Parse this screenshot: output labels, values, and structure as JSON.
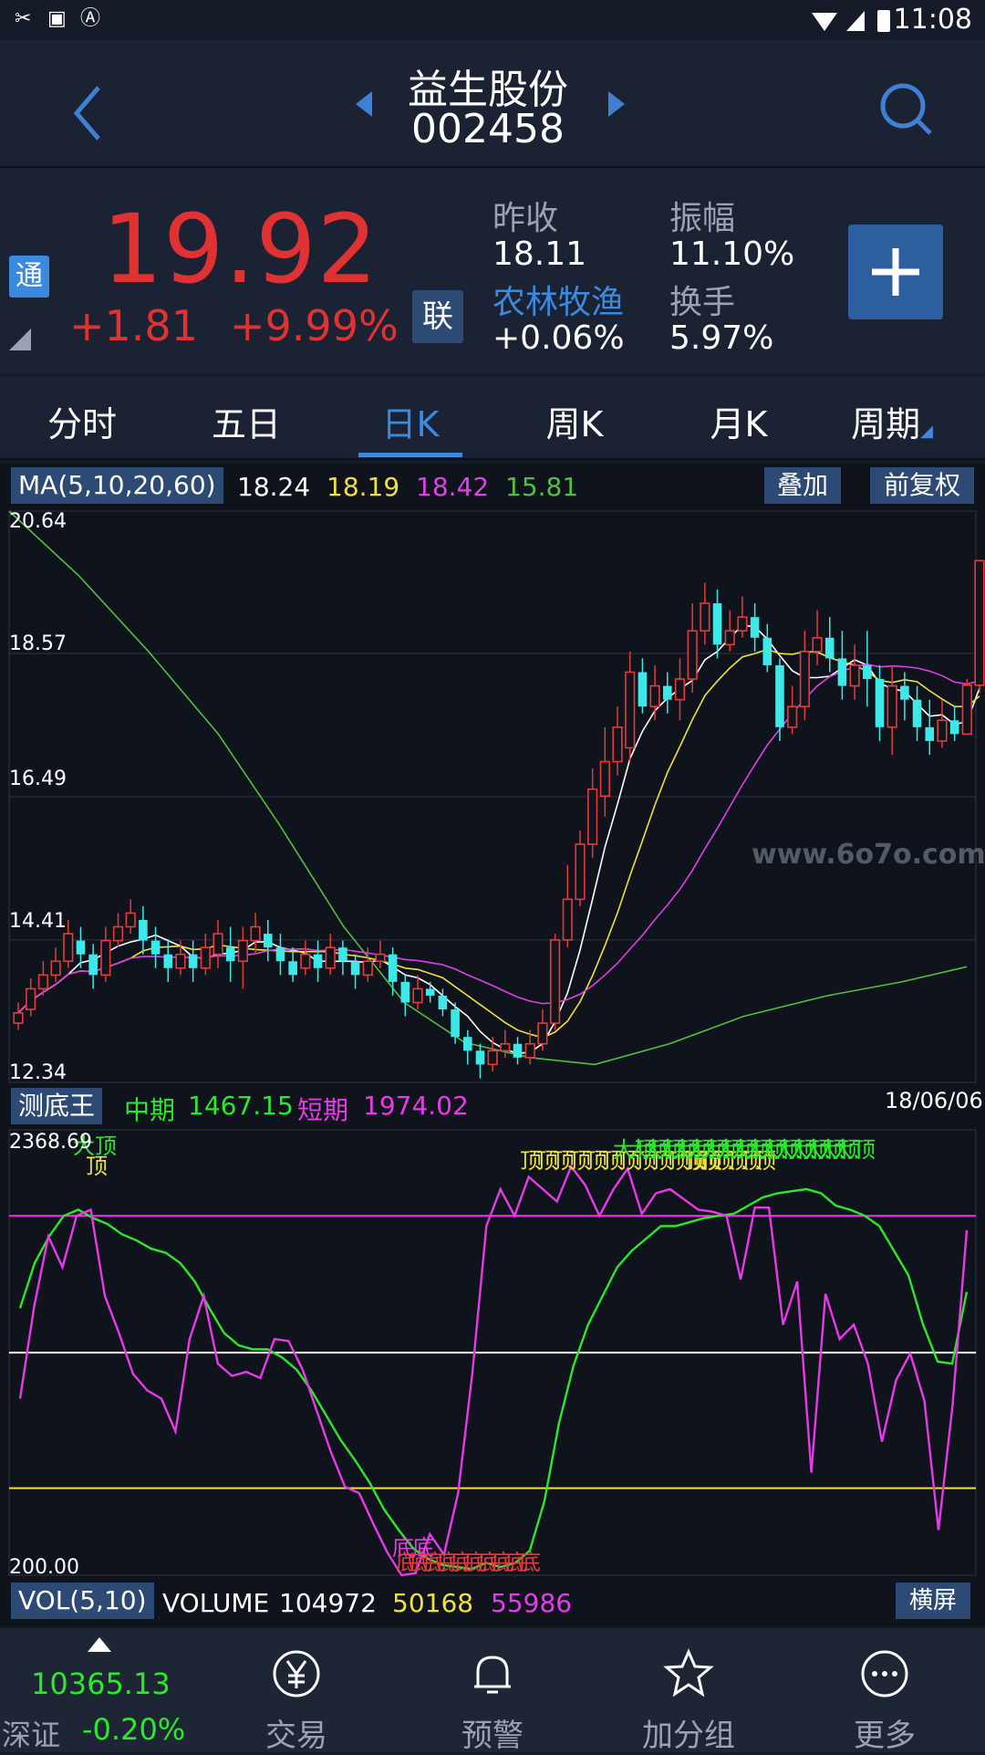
{
  "status_bar": {
    "time": "11:08"
  },
  "header": {
    "stock_name": "益生股份",
    "stock_code": "002458"
  },
  "quote": {
    "tong": "通",
    "price": "19.92",
    "change": "+1.81",
    "change_pct": "+9.99%",
    "lian": "联",
    "prev_close_label": "昨收",
    "prev_close": "18.11",
    "amplitude_label": "振幅",
    "amplitude": "11.10%",
    "sector": "农林牧渔",
    "sector_change": "+0.06%",
    "turnover_label": "换手",
    "turnover": "5.97%"
  },
  "tabs": [
    {
      "label": "分时"
    },
    {
      "label": "五日"
    },
    {
      "label": "日K"
    },
    {
      "label": "周K"
    },
    {
      "label": "月K"
    },
    {
      "label": "周期"
    }
  ],
  "ma_bar": {
    "label": "MA(5,10,20,60)",
    "values": [
      "18.24",
      "18.19",
      "18.42",
      "15.81"
    ],
    "colors": [
      "#ffffff",
      "#f0e040",
      "#e040e8",
      "#50c040"
    ],
    "overlay_label": "叠加",
    "fq_label": "前复权"
  },
  "chart_data": [
    {
      "type": "candlestick",
      "y_ticks": [
        "20.64",
        "18.57",
        "16.49",
        "14.41",
        "12.34"
      ],
      "ylim": [
        12.34,
        20.64
      ],
      "date_label": "18/06/06",
      "watermark": "www.6o7o.com",
      "candles": [
        [
          13.2,
          13.35,
          13.1,
          13.5
        ],
        [
          13.4,
          13.7,
          13.3,
          13.85
        ],
        [
          13.7,
          13.9,
          13.6,
          14.1
        ],
        [
          13.9,
          14.1,
          13.8,
          14.3
        ],
        [
          14.1,
          14.5,
          14.0,
          14.7
        ],
        [
          14.4,
          14.2,
          14.0,
          14.6
        ],
        [
          14.2,
          13.9,
          13.7,
          14.35
        ],
        [
          13.9,
          14.4,
          13.8,
          14.6
        ],
        [
          14.4,
          14.6,
          14.3,
          14.8
        ],
        [
          14.6,
          14.8,
          14.5,
          15.0
        ],
        [
          14.7,
          14.4,
          14.2,
          14.9
        ],
        [
          14.4,
          14.2,
          14.0,
          14.6
        ],
        [
          14.2,
          14.0,
          13.8,
          14.4
        ],
        [
          14.0,
          14.2,
          13.9,
          14.4
        ],
        [
          14.2,
          14.0,
          13.8,
          14.4
        ],
        [
          14.0,
          14.3,
          13.9,
          14.5
        ],
        [
          14.2,
          14.5,
          14.0,
          14.7
        ],
        [
          14.3,
          14.1,
          13.8,
          14.6
        ],
        [
          14.1,
          14.4,
          13.7,
          14.6
        ],
        [
          14.4,
          14.6,
          14.2,
          14.8
        ],
        [
          14.5,
          14.3,
          14.1,
          14.7
        ],
        [
          14.3,
          14.1,
          13.9,
          14.5
        ],
        [
          14.1,
          13.9,
          13.8,
          14.3
        ],
        [
          14.0,
          14.2,
          13.9,
          14.4
        ],
        [
          14.2,
          14.0,
          13.8,
          14.4
        ],
        [
          14.0,
          14.3,
          13.9,
          14.5
        ],
        [
          14.3,
          14.1,
          13.9,
          14.4
        ],
        [
          14.1,
          13.9,
          13.7,
          14.2
        ],
        [
          13.9,
          14.1,
          13.8,
          14.3
        ],
        [
          14.1,
          14.2,
          14.0,
          14.4
        ],
        [
          14.2,
          13.8,
          13.6,
          14.3
        ],
        [
          13.8,
          13.5,
          13.3,
          13.9
        ],
        [
          13.5,
          13.7,
          13.4,
          13.9
        ],
        [
          13.7,
          13.6,
          13.5,
          13.8
        ],
        [
          13.6,
          13.4,
          13.3,
          13.7
        ],
        [
          13.4,
          13.0,
          12.9,
          13.5
        ],
        [
          13.0,
          12.8,
          12.6,
          13.1
        ],
        [
          12.8,
          12.6,
          12.4,
          12.9
        ],
        [
          12.6,
          12.8,
          12.5,
          13.0
        ],
        [
          12.8,
          12.9,
          12.7,
          13.1
        ],
        [
          12.9,
          12.7,
          12.6,
          13.0
        ],
        [
          12.7,
          12.9,
          12.6,
          13.1
        ],
        [
          12.9,
          13.2,
          12.8,
          13.4
        ],
        [
          13.2,
          14.41,
          13.1,
          14.5
        ],
        [
          14.41,
          15.0,
          14.3,
          15.5
        ],
        [
          15.0,
          15.8,
          14.9,
          16.0
        ],
        [
          15.8,
          16.6,
          15.6,
          16.9
        ],
        [
          16.5,
          17.0,
          16.2,
          17.5
        ],
        [
          17.0,
          17.5,
          16.8,
          17.8
        ],
        [
          17.2,
          18.3,
          17.0,
          18.6
        ],
        [
          18.3,
          17.8,
          17.7,
          18.5
        ],
        [
          17.8,
          18.1,
          17.6,
          18.4
        ],
        [
          18.1,
          17.9,
          17.7,
          18.3
        ],
        [
          17.9,
          18.2,
          17.6,
          18.5
        ],
        [
          18.2,
          18.9,
          18.0,
          19.3
        ],
        [
          18.9,
          19.3,
          18.7,
          19.6
        ],
        [
          19.3,
          18.7,
          18.5,
          19.5
        ],
        [
          18.7,
          18.9,
          18.6,
          19.2
        ],
        [
          18.9,
          19.1,
          18.8,
          19.4
        ],
        [
          19.1,
          18.8,
          18.6,
          19.3
        ],
        [
          18.8,
          18.4,
          18.3,
          19.0
        ],
        [
          18.4,
          17.5,
          17.3,
          18.5
        ],
        [
          17.5,
          17.8,
          17.4,
          18.1
        ],
        [
          17.8,
          18.6,
          17.6,
          18.9
        ],
        [
          18.6,
          18.8,
          18.4,
          19.2
        ],
        [
          18.8,
          18.5,
          18.3,
          19.1
        ],
        [
          18.5,
          18.1,
          17.9,
          18.9
        ],
        [
          18.1,
          18.4,
          17.9,
          18.7
        ],
        [
          18.4,
          18.2,
          17.8,
          18.9
        ],
        [
          18.2,
          17.5,
          17.3,
          18.4
        ],
        [
          17.5,
          18.1,
          17.1,
          18.4
        ],
        [
          18.1,
          17.9,
          17.6,
          18.3
        ],
        [
          17.9,
          17.5,
          17.3,
          18.1
        ],
        [
          17.5,
          17.3,
          17.1,
          17.9
        ],
        [
          17.3,
          17.6,
          17.2,
          17.9
        ],
        [
          17.6,
          17.4,
          17.3,
          17.8
        ],
        [
          17.4,
          18.11,
          17.4,
          18.2
        ],
        [
          18.11,
          19.92,
          18.0,
          19.92
        ]
      ],
      "ma60_points": [
        [
          0,
          20.64
        ],
        [
          15,
          19.7
        ],
        [
          30,
          18.6
        ],
        [
          45,
          17.4
        ],
        [
          58,
          16.1
        ],
        [
          72,
          14.6
        ],
        [
          85,
          13.5
        ],
        [
          98,
          12.92
        ],
        [
          112,
          12.7
        ],
        [
          126,
          12.6
        ],
        [
          142,
          12.9
        ],
        [
          158,
          13.3
        ],
        [
          176,
          13.6
        ],
        [
          192,
          13.8
        ],
        [
          206,
          14.02
        ]
      ]
    },
    {
      "type": "line",
      "title": "测底王",
      "series_labels": [
        {
          "name": "中期",
          "value": "1467.15",
          "color": "#2be82b"
        },
        {
          "name": "短期",
          "value": "1974.02",
          "color": "#e83ae8"
        }
      ],
      "y_ticks": [
        "2368.69",
        "200.00"
      ],
      "ylim": [
        200.0,
        2368.69
      ],
      "levels": [
        1950,
        1284,
        624
      ],
      "top_marks": [
        "大顶",
        "顶"
      ],
      "bottom_marks": [
        "底",
        "底"
      ],
      "mid_series": [
        1500,
        1720,
        1850,
        1950,
        1980,
        1940,
        1910,
        1860,
        1830,
        1790,
        1770,
        1720,
        1630,
        1500,
        1380,
        1320,
        1300,
        1300,
        1260,
        1200,
        1100,
        980,
        860,
        760,
        650,
        520,
        420,
        330,
        280,
        250,
        240,
        230,
        260,
        240,
        260,
        320,
        560,
        940,
        1220,
        1420,
        1560,
        1700,
        1780,
        1840,
        1900,
        1900,
        1920,
        1940,
        1950,
        1960,
        2000,
        2040,
        2060,
        2070,
        2080,
        2060,
        2000,
        1980,
        1950,
        1900,
        1780,
        1660,
        1420,
        1240,
        1230,
        1580
      ],
      "short_series": [
        1060,
        1510,
        1850,
        1700,
        1950,
        1980,
        1560,
        1380,
        1180,
        1100,
        1060,
        900,
        1350,
        1560,
        1230,
        1170,
        1190,
        1160,
        1350,
        1340,
        1200,
        1000,
        800,
        630,
        600,
        450,
        310,
        200,
        210,
        400,
        300,
        600,
        1180,
        1900,
        2080,
        1950,
        2140,
        2080,
        2020,
        2190,
        2100,
        1950,
        2080,
        2180,
        1960,
        2060,
        2080,
        2030,
        1980,
        1970,
        1950,
        1640,
        1990,
        1990,
        1420,
        1630,
        700,
        1570,
        1350,
        1420,
        1230,
        850,
        1150,
        1280,
        1050,
        420,
        1030,
        1880
      ]
    }
  ],
  "indicator_bar": {
    "label": "测底王"
  },
  "volume_bar": {
    "label": "VOL(5,10)",
    "volume_label": "VOLUME",
    "volume": "104972",
    "ma5": "50168",
    "ma10": "55986",
    "landscape_label": "横屏"
  },
  "bottom_nav": {
    "index_value": "10365.13",
    "index_name": "深证",
    "index_change": "-0.20%",
    "items": [
      {
        "label": "交易",
        "icon": "yuan-coin-icon"
      },
      {
        "label": "预警",
        "icon": "bell-icon"
      },
      {
        "label": "加分组",
        "icon": "star-icon"
      },
      {
        "label": "更多",
        "icon": "more-icon"
      }
    ]
  }
}
